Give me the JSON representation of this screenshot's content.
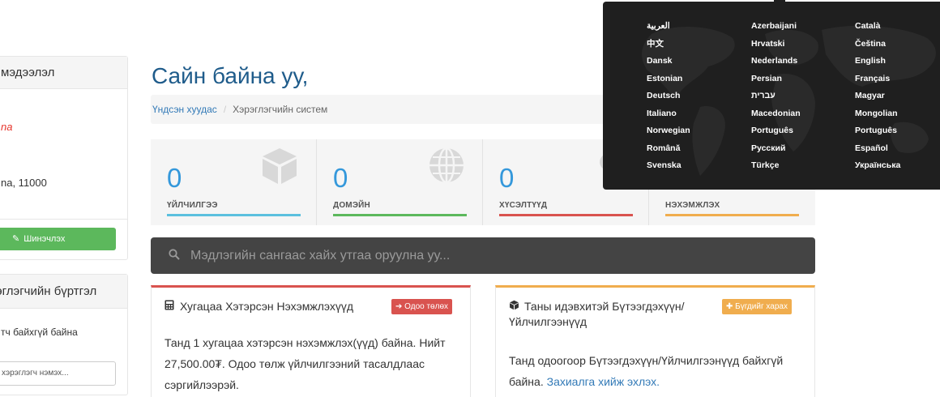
{
  "sidebar": {
    "panel1": {
      "heading": "мэдээлэл",
      "name": "na",
      "address": "na, 11000",
      "update_button": "Шинэчлэх"
    },
    "panel2": {
      "heading": "эглэгчийн бүртгэл",
      "empty_text": "тч байхгүй байна",
      "add_input_text": "хэрэглэгч нэмэх..."
    }
  },
  "main": {
    "title": "Сайн байна уу,",
    "breadcrumb": {
      "home": "Үндсэн хуудас",
      "separator": "/",
      "current": "Хэрэглэгчийн систем"
    },
    "stats": [
      {
        "value": "0",
        "label": "ҮЙЛЧИЛГЭЭ",
        "color": "#5bc0de",
        "icon": "cube-icon"
      },
      {
        "value": "0",
        "label": "ДОМЭЙН",
        "color": "#5cb85c",
        "icon": "globe-icon"
      },
      {
        "value": "0",
        "label": "ХҮСЭЛТҮҮД",
        "color": "#d9534f",
        "icon": "comments-icon"
      },
      {
        "value": "",
        "label": "НЭХЭМЖЛЭХ",
        "color": "#f0ad4e",
        "icon": "credit-card-icon"
      }
    ],
    "search": {
      "placeholder": "Мэдлэгийн сангаас хайх утгаа оруулна уу..."
    },
    "cards": {
      "overdue": {
        "title": "Хугацаа Хэтэрсэн Нэхэмжлэхүүд",
        "button": "Одоо төлөх",
        "body": "Танд 1 хугацаа хэтэрсэн нэхэмжлэх(үүд) байна. Нийт 27,500.00₮. Одоо төлж үйлчилгээний тасалдлаас сэргийлээрэй."
      },
      "active": {
        "title": "Таны идэвхитэй Бүтээгдэхүүн/ Үйлчилгээнүүд",
        "button": "Бүгдийг харах",
        "body": "Танд одоогоор Бүтээгдэхүүн/Үйлчилгээнүүд байхгүй байна.",
        "link": "Захиалга хийж эхлэх."
      }
    }
  },
  "language_menu": {
    "col1": [
      "العربية",
      "中文",
      "Dansk",
      "Estonian",
      "Deutsch",
      "Italiano",
      "Norwegian",
      "Română",
      "Svenska"
    ],
    "col2": [
      "Azerbaijani",
      "Hrvatski",
      "Nederlands",
      "Persian",
      "עברית",
      "Macedonian",
      "Português",
      "Русский",
      "Türkçe"
    ],
    "col3": [
      "Català",
      "Čeština",
      "English",
      "Français",
      "Magyar",
      "Mongolian",
      "Português",
      "Español",
      "Українська"
    ]
  }
}
